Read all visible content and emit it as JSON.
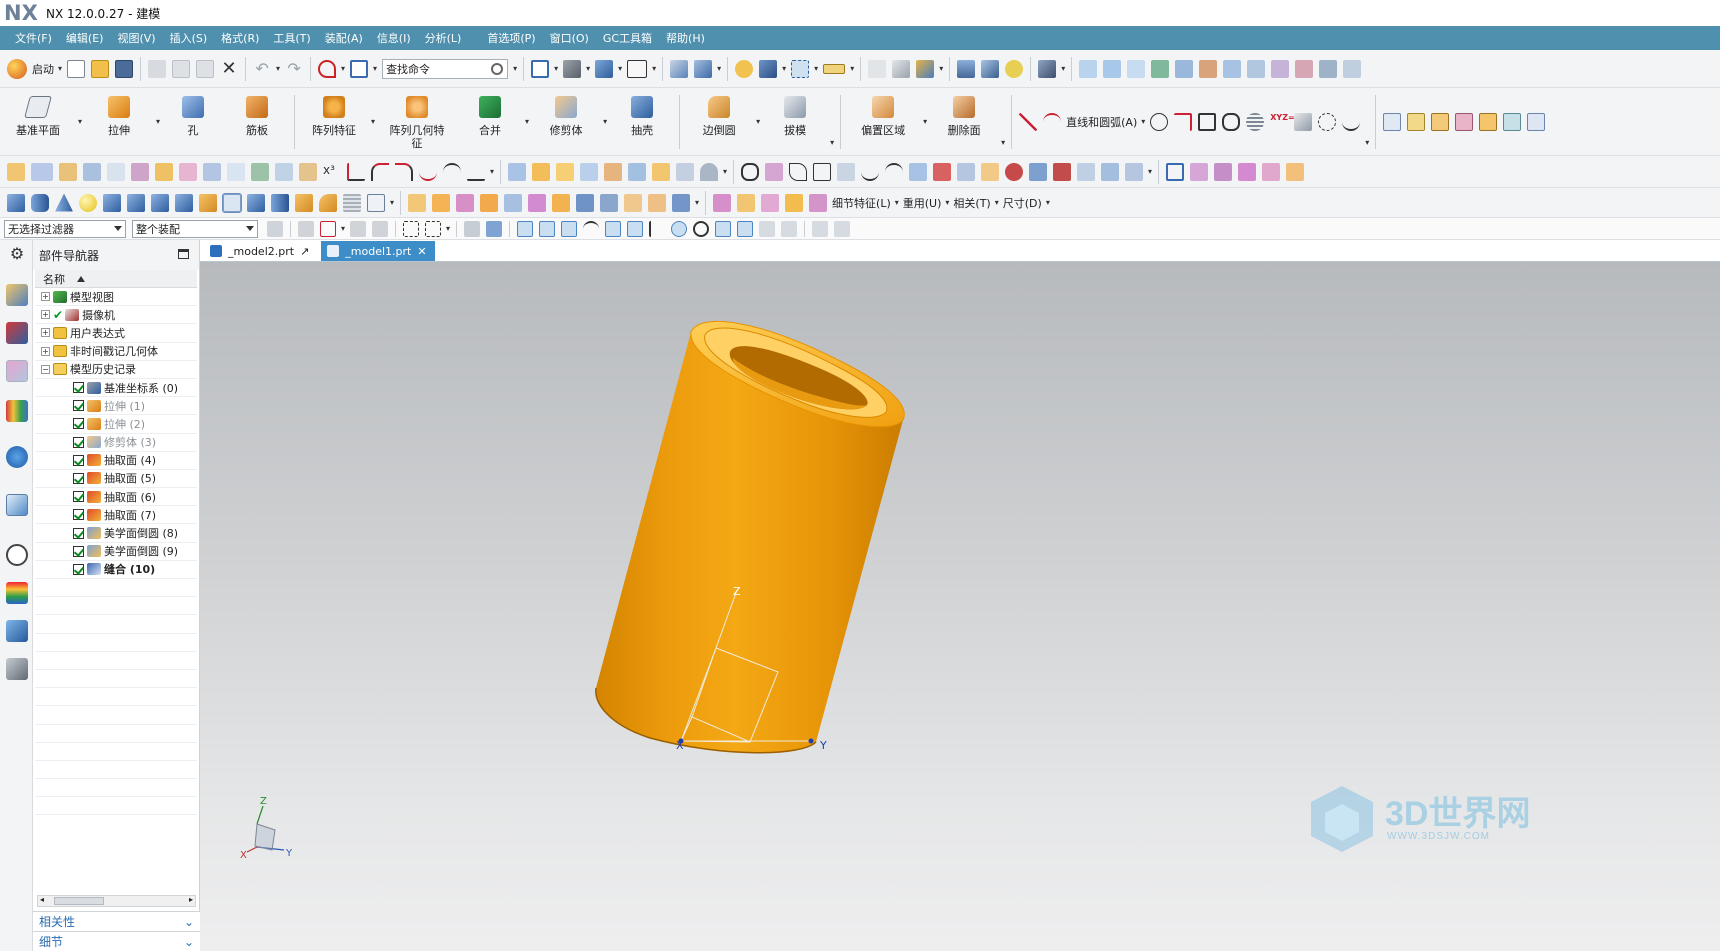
{
  "window": {
    "app_logo": "NX",
    "title": "NX 12.0.0.27 - 建模"
  },
  "menu": [
    "文件(F)",
    "编辑(E)",
    "视图(V)",
    "插入(S)",
    "格式(R)",
    "工具(T)",
    "装配(A)",
    "信息(I)",
    "分析(L)",
    "首选项(P)",
    "窗口(O)",
    "GC工具箱",
    "帮助(H)"
  ],
  "toolbar1": {
    "start_label": "启动",
    "search_placeholder": "查找命令"
  },
  "toolbar2": {
    "buttons": [
      "基准平面",
      "拉伸",
      "孔",
      "筋板",
      "阵列特征",
      "阵列几何特征",
      "合并",
      "修剪体",
      "抽壳",
      "边倒圆",
      "拔模",
      "偏置区域",
      "删除面"
    ],
    "curve_label": "直线和圆弧(A)"
  },
  "toolbar4": {
    "menus": [
      "细节特征(L)",
      "重用(U)",
      "相关(T)",
      "尺寸(D)"
    ]
  },
  "filters": {
    "selection_filter": "无选择过滤器",
    "scope": "整个装配"
  },
  "navigator": {
    "title": "部件导航器",
    "column": "名称",
    "items": [
      {
        "label": "模型视图",
        "indent": 0,
        "expander": "+",
        "check": false,
        "style": "normal",
        "icon": "model-views-icon"
      },
      {
        "label": "摄像机",
        "indent": 0,
        "expander": "+",
        "check": true,
        "style": "normal",
        "icon": "camera-icon"
      },
      {
        "label": "用户表达式",
        "indent": 0,
        "expander": "+",
        "check": false,
        "style": "normal",
        "icon": "folder-icon"
      },
      {
        "label": "非时间戳记几何体",
        "indent": 0,
        "expander": "+",
        "check": false,
        "style": "normal",
        "icon": "folder-icon"
      },
      {
        "label": "模型历史记录",
        "indent": 0,
        "expander": "−",
        "check": false,
        "style": "normal",
        "icon": "folder-open-icon"
      },
      {
        "label": "基准坐标系 (0)",
        "indent": 1,
        "expander": "",
        "check": true,
        "style": "normal",
        "icon": "datum-csys-icon"
      },
      {
        "label": "拉伸 (1)",
        "indent": 1,
        "expander": "",
        "check": true,
        "style": "dim",
        "icon": "extrude-icon"
      },
      {
        "label": "拉伸 (2)",
        "indent": 1,
        "expander": "",
        "check": true,
        "style": "dim",
        "icon": "extrude-icon"
      },
      {
        "label": "修剪体 (3)",
        "indent": 1,
        "expander": "",
        "check": true,
        "style": "dim",
        "icon": "trim-body-icon"
      },
      {
        "label": "抽取面 (4)",
        "indent": 1,
        "expander": "",
        "check": true,
        "style": "normal",
        "icon": "extract-face-icon"
      },
      {
        "label": "抽取面 (5)",
        "indent": 1,
        "expander": "",
        "check": true,
        "style": "normal",
        "icon": "extract-face-icon"
      },
      {
        "label": "抽取面 (6)",
        "indent": 1,
        "expander": "",
        "check": true,
        "style": "normal",
        "icon": "extract-face-icon"
      },
      {
        "label": "抽取面 (7)",
        "indent": 1,
        "expander": "",
        "check": true,
        "style": "normal",
        "icon": "extract-face-icon"
      },
      {
        "label": "美学面倒圆 (8)",
        "indent": 1,
        "expander": "",
        "check": true,
        "style": "normal",
        "icon": "aesthetic-blend-icon"
      },
      {
        "label": "美学面倒圆 (9)",
        "indent": 1,
        "expander": "",
        "check": true,
        "style": "normal",
        "icon": "aesthetic-blend-icon"
      },
      {
        "label": "缝合 (10)",
        "indent": 1,
        "expander": "",
        "check": true,
        "style": "bold",
        "icon": "sew-icon"
      }
    ],
    "panels": [
      "相关性",
      "细节"
    ]
  },
  "tabs": [
    {
      "label": "_model2.prt",
      "active": false,
      "modified_marker": "↗"
    },
    {
      "label": "_model1.prt",
      "active": true,
      "modified_marker": "✕"
    }
  ],
  "viewport": {
    "axis_labels": {
      "x": "X",
      "y": "Y",
      "z": "Z"
    },
    "model_color": "#f0a010"
  },
  "watermark": {
    "text": "3D世界网",
    "sub": "WWW.3DSJW.COM"
  },
  "colors": {
    "menubar": "#4e90ad",
    "tab_active": "#3d8ec8",
    "model_orange": "#f0a010"
  }
}
